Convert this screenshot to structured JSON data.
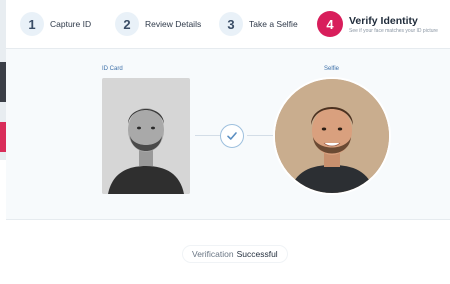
{
  "steps": [
    {
      "number": "1",
      "label": "Capture ID"
    },
    {
      "number": "2",
      "label": "Review Details"
    },
    {
      "number": "3",
      "label": "Take a Selfie"
    },
    {
      "number": "4",
      "label": "Verify Identity",
      "sublabel": "See if your face matches your ID picture"
    }
  ],
  "verification": {
    "id_card_label": "ID Card",
    "selfie_label": "Selfie"
  },
  "status": {
    "prefix": "Verification",
    "result": "Successful"
  },
  "colors": {
    "active_step": "#d81e5b",
    "inactive_step_bg": "#e9f1f8",
    "label_blue": "#3c6fa8",
    "check": "#5b8fc2"
  },
  "icons": {
    "match": "check-icon",
    "id_photo": "person-portrait",
    "selfie_photo": "person-portrait"
  }
}
